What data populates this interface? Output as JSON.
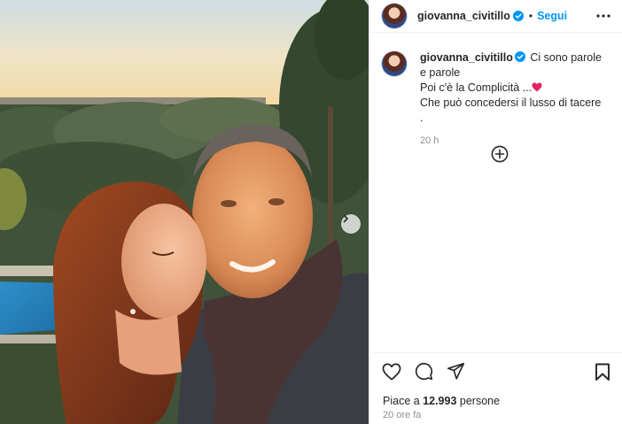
{
  "post": {
    "username": "giovanna_civitillo",
    "follow_label": "Segui",
    "separator": "•",
    "caption": {
      "line1": "Ci sono parole e parole",
      "line2": "Poi c'è la Complicità ...",
      "line3": "Che può concedersi il lusso di tacere ."
    },
    "caption_time": "20 h",
    "likes_prefix": "Piace a ",
    "likes_count": "12.993",
    "likes_suffix": " persone",
    "time_ago": "20 ore fa"
  },
  "icons": {
    "verified": "verified-badge-icon",
    "more": "more-options-icon",
    "carousel_next": "chevron-right-icon",
    "add_comment": "plus-circle-icon",
    "like": "heart-icon",
    "comment": "comment-icon",
    "share": "send-icon",
    "save": "bookmark-icon"
  },
  "colors": {
    "accent": "#0095f6",
    "text": "#262626",
    "secondary": "#8e8e8e",
    "heart_emoji": "#e0245e"
  }
}
